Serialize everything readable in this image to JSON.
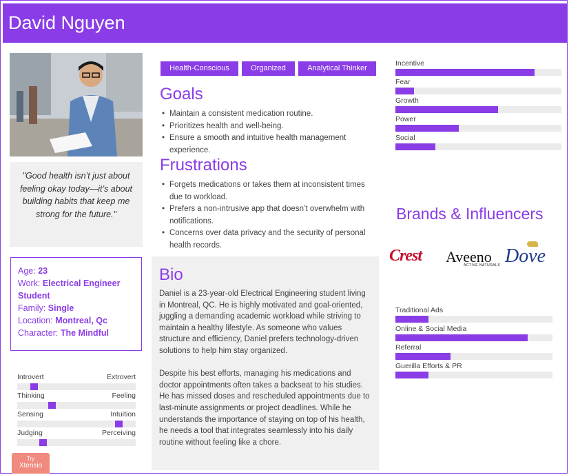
{
  "persona": {
    "name": "David Nguyen",
    "quote": "\"Good health isn’t just about feeling okay today—it’s about building habits that keep me strong for the future.\""
  },
  "info": [
    {
      "label": "Age:",
      "value": "23"
    },
    {
      "label": "Work:",
      "value": "Electrical Engineer Student"
    },
    {
      "label": "Family:",
      "value": "Single"
    },
    {
      "label": "Location:",
      "value": "Montreal, Qc"
    },
    {
      "label": "Character:",
      "value": "The Mindful"
    }
  ],
  "personality": [
    {
      "left": "Introvert",
      "right": "Extrovert",
      "value": 0.12
    },
    {
      "left": "Thinking",
      "right": "Feeling",
      "value": 0.28
    },
    {
      "left": "Sensing",
      "right": "Intuition",
      "value": 0.88
    },
    {
      "left": "Judging",
      "right": "Perceiving",
      "value": 0.2
    }
  ],
  "tags": [
    "Health-Conscious",
    "Organized",
    "Analytical Thinker"
  ],
  "goals": {
    "title": "Goals",
    "items": [
      "Maintain a consistent medication routine.",
      "Prioritizes health and well-being.",
      "Ensure a smooth and intuitive health management experience."
    ]
  },
  "frustrations": {
    "title": "Frustrations",
    "items": [
      "Forgets medications or takes them at inconsistent times due to workload.",
      "Prefers a non-intrusive app that doesn’t overwhelm with notifications.",
      "Concerns over data privacy and the security of personal health records."
    ]
  },
  "bio": {
    "title": "Bio",
    "paragraphs": [
      "Daniel is a 23-year-old Electrical Engineering student living in Montreal, QC. He is highly motivated and goal-oriented, juggling a demanding academic workload while striving to maintain a healthy lifestyle. As someone who values structure and efficiency, Daniel prefers technology-driven solutions to help him stay organized.",
      "Despite his best efforts, managing his medications and doctor appointments often takes a backseat to his studies. He has missed doses and rescheduled appointments due to last-minute assignments or project deadlines. While he understands the importance of staying on top of his health, he needs a tool that integrates seamlessly into his daily routine without feeling like a chore."
    ]
  },
  "motivations": [
    {
      "label": "Incentive",
      "value": 0.84
    },
    {
      "label": "Fear",
      "value": 0.11
    },
    {
      "label": "Growth",
      "value": 0.62
    },
    {
      "label": "Power",
      "value": 0.38
    },
    {
      "label": "Social",
      "value": 0.24
    }
  ],
  "brands": {
    "title": "Brands & Influencers",
    "logos": [
      {
        "name": "Crest",
        "color": "#c8102e"
      },
      {
        "name": "Aveeno",
        "sub": "ACTIVE NATURALS",
        "color": "#111111"
      },
      {
        "name": "Dove",
        "color": "#1f3b8c"
      }
    ]
  },
  "channels": [
    {
      "label": "Traditional Ads",
      "value": 0.21
    },
    {
      "label": "Online & Social Media",
      "value": 0.84
    },
    {
      "label": "Referral",
      "value": 0.35
    },
    {
      "label": "Guerilla Efforts & PR",
      "value": 0.21
    }
  ],
  "badge": {
    "line1": "Try",
    "line2": "Xtensio"
  },
  "colors": {
    "accent": "#8a3ce6",
    "track": "#ebebeb",
    "panel": "#f0f0f0"
  }
}
